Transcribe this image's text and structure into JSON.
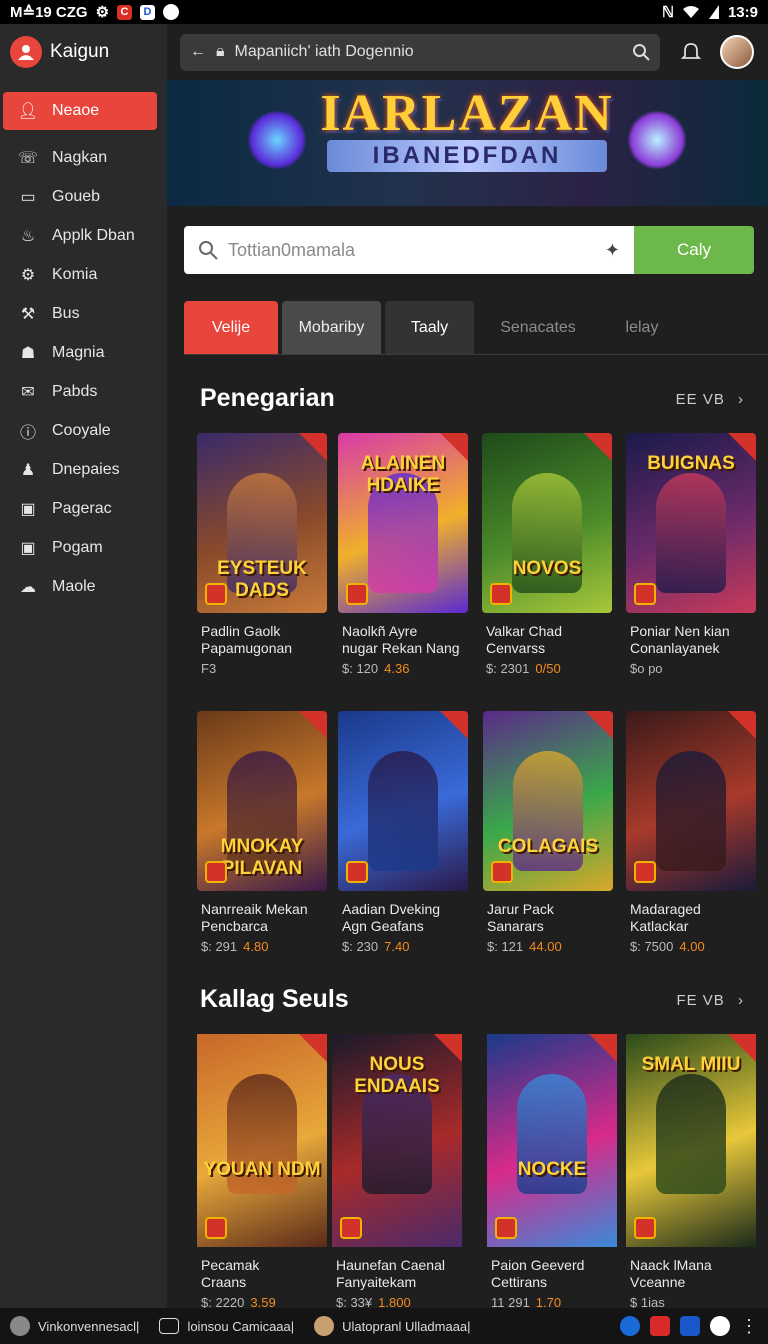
{
  "status_bar": {
    "left_text": "M≙19 CZG",
    "badge_red": "C",
    "badge_blue": "D",
    "time": "13:9"
  },
  "brand": {
    "name": "Kaigun"
  },
  "sidebar": {
    "items": [
      {
        "label": "Neaoe",
        "icon": "user-icon",
        "active": true
      },
      {
        "label": "Nagkan",
        "icon": "phone-icon"
      },
      {
        "label": "Goueb",
        "icon": "window-icon"
      },
      {
        "label": "Applk Dban",
        "icon": "leaf-icon"
      },
      {
        "label": "Komia",
        "icon": "gear-icon"
      },
      {
        "label": "Bus",
        "icon": "wrench-icon"
      },
      {
        "label": "Magnia",
        "icon": "gamepad-icon"
      },
      {
        "label": "Pabds",
        "icon": "mail-icon"
      },
      {
        "label": "Cooyale",
        "icon": "info-icon"
      },
      {
        "label": "Dnepaies",
        "icon": "puzzle-icon"
      },
      {
        "label": "Pagerac",
        "icon": "inbox-icon"
      },
      {
        "label": "Pogam",
        "icon": "inbox-icon"
      },
      {
        "label": "Maole",
        "icon": "cloud-icon"
      }
    ]
  },
  "topbar": {
    "url": "Mapaniich' iath Dogennio"
  },
  "banner": {
    "title": "IARLAZAN",
    "subtitle": "IBANEDFDAN"
  },
  "search": {
    "placeholder": "Tottian0mamala",
    "button": "Caly"
  },
  "tabs": [
    "Velije",
    "Mobariby",
    "Taaly",
    "Senacates",
    "lelay"
  ],
  "sections": [
    {
      "title": "Penegarian",
      "see_all": "EE VB"
    },
    {
      "title": "Kallag Seuls",
      "see_all": "FE VB"
    }
  ],
  "row1": [
    {
      "art": "EYSTEUK DADS",
      "line1": "Padlin Gaolk",
      "line2": "Papamugonan",
      "price": "F3",
      "price_hl": "",
      "colors": [
        "#3a2a6a",
        "#8a4a2a",
        "#c87a3a"
      ]
    },
    {
      "art": "ALAINEN HDAIKE",
      "line1": "Naolkñ Ayre",
      "line2": "nugar Rekan Nang",
      "price": "$: 120",
      "price_hl": "4.36",
      "colors": [
        "#d83aa8",
        "#f0b02a",
        "#5a2ad0"
      ]
    },
    {
      "art": "NOVOS",
      "line1": "Valkar Chad",
      "line2": "Cenvarss",
      "price": "$: 2301",
      "price_hl": "0/50",
      "colors": [
        "#1e4a1a",
        "#4a8a2a",
        "#a8c83a"
      ]
    },
    {
      "art": "BUIGNAS",
      "line1": "Poniar Nen kian",
      "line2": "Conanlayanek",
      "price": "$o po",
      "price_hl": "",
      "colors": [
        "#1a1a4a",
        "#6a2a6a",
        "#c83a5a"
      ]
    }
  ],
  "row2": [
    {
      "art": "MNOKAY PILAVAN",
      "line1": "Nanrreaik Mekan",
      "line2": "Pencbarca",
      "price": "$: 291",
      "price_hl": "4.80",
      "colors": [
        "#6a3a1a",
        "#c8782a",
        "#3a1a4a"
      ]
    },
    {
      "art": "",
      "line1": "Aadian Dveking",
      "line2": "Agn Geafans",
      "price": "$: 230",
      "price_hl": "7.40",
      "colors": [
        "#1a3a8a",
        "#3a6ad8",
        "#2a1a4a"
      ]
    },
    {
      "art": "COLAGAIS",
      "line1": "Jarur Pack",
      "line2": "Sanarars",
      "price": "$: 121",
      "price_hl": "44.00",
      "colors": [
        "#5a2a8a",
        "#3aa84a",
        "#d8a82a"
      ]
    },
    {
      "art": "",
      "line1": "Madaraged",
      "line2": "Katlackar",
      "price": "$: 7500",
      "price_hl": "4.00",
      "colors": [
        "#3a1a1a",
        "#a83a2a",
        "#1a1a3a"
      ]
    }
  ],
  "row3": [
    {
      "art": "YOUAN NDM",
      "line1": "Pecamak",
      "line2": "Craans",
      "price": "$: 2220",
      "price_hl": "3.59",
      "colors": [
        "#c8682a",
        "#e8a83a",
        "#5a2a1a"
      ]
    },
    {
      "art": "NOUS ENDAAIS",
      "line1": "Haunefan Caenal",
      "line2": "Fanyaitekam",
      "price": "$: 33¥",
      "price_hl": "1.800",
      "colors": [
        "#1a1a2a",
        "#a82a2a",
        "#4a2a6a"
      ]
    },
    {
      "art": "NOCKE",
      "line1": "Paion Geeverd",
      "line2": "Cettirans",
      "price": "11 291",
      "price_hl": "1.70",
      "colors": [
        "#1a3a8a",
        "#d82a8a",
        "#3a8ad8"
      ]
    },
    {
      "art": "SMAL MIIU",
      "line1": "Naack lMana",
      "line2": "Vceanne",
      "price": "$ 1ias",
      "price_hl": "",
      "colors": [
        "#2a4a1a",
        "#e8c83a",
        "#1a2a1a"
      ]
    }
  ],
  "taskbar": {
    "items": [
      "Vinkonvennesacl|",
      "loinsou Camicaaa|",
      "Ulatopranl Ulladmaaa|"
    ]
  }
}
